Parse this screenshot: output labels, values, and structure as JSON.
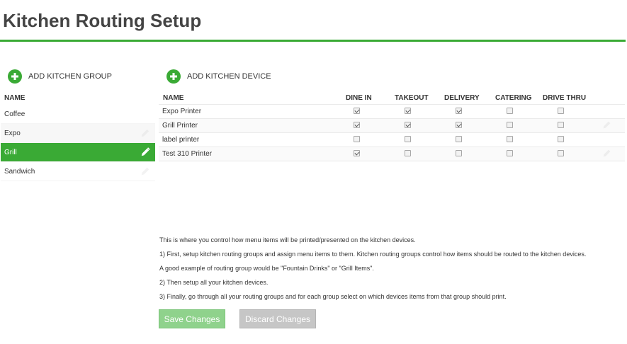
{
  "page": {
    "title": "Kitchen Routing Setup"
  },
  "groups": {
    "add_label": "ADD KITCHEN GROUP",
    "name_header": "NAME",
    "items": [
      {
        "label": "Coffee",
        "selected": false
      },
      {
        "label": "Expo",
        "selected": false
      },
      {
        "label": "Grill",
        "selected": true
      },
      {
        "label": "Sandwich",
        "selected": false
      }
    ]
  },
  "devices": {
    "add_label": "ADD KITCHEN DEVICE",
    "headers": [
      "NAME",
      "DINE IN",
      "TAKEOUT",
      "DELIVERY",
      "CATERING",
      "DRIVE THRU"
    ],
    "rows": [
      {
        "name": "Expo Printer",
        "checks": [
          true,
          true,
          true,
          false,
          false
        ]
      },
      {
        "name": "Grill Printer",
        "checks": [
          true,
          true,
          true,
          false,
          false
        ]
      },
      {
        "name": "label printer",
        "checks": [
          false,
          false,
          false,
          false,
          false
        ]
      },
      {
        "name": "Test 310 Printer",
        "checks": [
          true,
          false,
          false,
          false,
          false
        ]
      }
    ]
  },
  "instructions": [
    "This is where you control how menu items will be printed/presented on the kitchen devices.",
    "1) First, setup kitchen routing groups and assign menu items to them. Kitchen routing groups control how items should be routed to the kitchen devices.",
    "A good example of routing group would be \"Fountain Drinks\" or \"Grill Items\".",
    "2) Then setup all your kitchen devices.",
    "3) Finally, go through all your routing groups and for each group select on which devices items from that group should print."
  ],
  "buttons": {
    "save": "Save Changes",
    "discard": "Discard Changes"
  },
  "colors": {
    "accent": "#3aaa35"
  }
}
